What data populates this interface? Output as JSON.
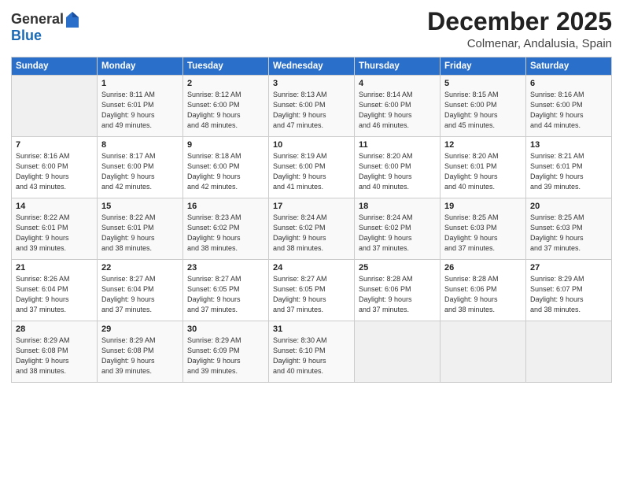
{
  "logo": {
    "general": "General",
    "blue": "Blue"
  },
  "header": {
    "month": "December 2025",
    "location": "Colmenar, Andalusia, Spain"
  },
  "weekdays": [
    "Sunday",
    "Monday",
    "Tuesday",
    "Wednesday",
    "Thursday",
    "Friday",
    "Saturday"
  ],
  "weeks": [
    [
      {
        "date": "",
        "info": ""
      },
      {
        "date": "1",
        "info": "Sunrise: 8:11 AM\nSunset: 6:01 PM\nDaylight: 9 hours\nand 49 minutes."
      },
      {
        "date": "2",
        "info": "Sunrise: 8:12 AM\nSunset: 6:00 PM\nDaylight: 9 hours\nand 48 minutes."
      },
      {
        "date": "3",
        "info": "Sunrise: 8:13 AM\nSunset: 6:00 PM\nDaylight: 9 hours\nand 47 minutes."
      },
      {
        "date": "4",
        "info": "Sunrise: 8:14 AM\nSunset: 6:00 PM\nDaylight: 9 hours\nand 46 minutes."
      },
      {
        "date": "5",
        "info": "Sunrise: 8:15 AM\nSunset: 6:00 PM\nDaylight: 9 hours\nand 45 minutes."
      },
      {
        "date": "6",
        "info": "Sunrise: 8:16 AM\nSunset: 6:00 PM\nDaylight: 9 hours\nand 44 minutes."
      }
    ],
    [
      {
        "date": "7",
        "info": "Sunrise: 8:16 AM\nSunset: 6:00 PM\nDaylight: 9 hours\nand 43 minutes."
      },
      {
        "date": "8",
        "info": "Sunrise: 8:17 AM\nSunset: 6:00 PM\nDaylight: 9 hours\nand 42 minutes."
      },
      {
        "date": "9",
        "info": "Sunrise: 8:18 AM\nSunset: 6:00 PM\nDaylight: 9 hours\nand 42 minutes."
      },
      {
        "date": "10",
        "info": "Sunrise: 8:19 AM\nSunset: 6:00 PM\nDaylight: 9 hours\nand 41 minutes."
      },
      {
        "date": "11",
        "info": "Sunrise: 8:20 AM\nSunset: 6:00 PM\nDaylight: 9 hours\nand 40 minutes."
      },
      {
        "date": "12",
        "info": "Sunrise: 8:20 AM\nSunset: 6:01 PM\nDaylight: 9 hours\nand 40 minutes."
      },
      {
        "date": "13",
        "info": "Sunrise: 8:21 AM\nSunset: 6:01 PM\nDaylight: 9 hours\nand 39 minutes."
      }
    ],
    [
      {
        "date": "14",
        "info": "Sunrise: 8:22 AM\nSunset: 6:01 PM\nDaylight: 9 hours\nand 39 minutes."
      },
      {
        "date": "15",
        "info": "Sunrise: 8:22 AM\nSunset: 6:01 PM\nDaylight: 9 hours\nand 38 minutes."
      },
      {
        "date": "16",
        "info": "Sunrise: 8:23 AM\nSunset: 6:02 PM\nDaylight: 9 hours\nand 38 minutes."
      },
      {
        "date": "17",
        "info": "Sunrise: 8:24 AM\nSunset: 6:02 PM\nDaylight: 9 hours\nand 38 minutes."
      },
      {
        "date": "18",
        "info": "Sunrise: 8:24 AM\nSunset: 6:02 PM\nDaylight: 9 hours\nand 37 minutes."
      },
      {
        "date": "19",
        "info": "Sunrise: 8:25 AM\nSunset: 6:03 PM\nDaylight: 9 hours\nand 37 minutes."
      },
      {
        "date": "20",
        "info": "Sunrise: 8:25 AM\nSunset: 6:03 PM\nDaylight: 9 hours\nand 37 minutes."
      }
    ],
    [
      {
        "date": "21",
        "info": "Sunrise: 8:26 AM\nSunset: 6:04 PM\nDaylight: 9 hours\nand 37 minutes."
      },
      {
        "date": "22",
        "info": "Sunrise: 8:27 AM\nSunset: 6:04 PM\nDaylight: 9 hours\nand 37 minutes."
      },
      {
        "date": "23",
        "info": "Sunrise: 8:27 AM\nSunset: 6:05 PM\nDaylight: 9 hours\nand 37 minutes."
      },
      {
        "date": "24",
        "info": "Sunrise: 8:27 AM\nSunset: 6:05 PM\nDaylight: 9 hours\nand 37 minutes."
      },
      {
        "date": "25",
        "info": "Sunrise: 8:28 AM\nSunset: 6:06 PM\nDaylight: 9 hours\nand 37 minutes."
      },
      {
        "date": "26",
        "info": "Sunrise: 8:28 AM\nSunset: 6:06 PM\nDaylight: 9 hours\nand 38 minutes."
      },
      {
        "date": "27",
        "info": "Sunrise: 8:29 AM\nSunset: 6:07 PM\nDaylight: 9 hours\nand 38 minutes."
      }
    ],
    [
      {
        "date": "28",
        "info": "Sunrise: 8:29 AM\nSunset: 6:08 PM\nDaylight: 9 hours\nand 38 minutes."
      },
      {
        "date": "29",
        "info": "Sunrise: 8:29 AM\nSunset: 6:08 PM\nDaylight: 9 hours\nand 39 minutes."
      },
      {
        "date": "30",
        "info": "Sunrise: 8:29 AM\nSunset: 6:09 PM\nDaylight: 9 hours\nand 39 minutes."
      },
      {
        "date": "31",
        "info": "Sunrise: 8:30 AM\nSunset: 6:10 PM\nDaylight: 9 hours\nand 40 minutes."
      },
      {
        "date": "",
        "info": ""
      },
      {
        "date": "",
        "info": ""
      },
      {
        "date": "",
        "info": ""
      }
    ]
  ]
}
